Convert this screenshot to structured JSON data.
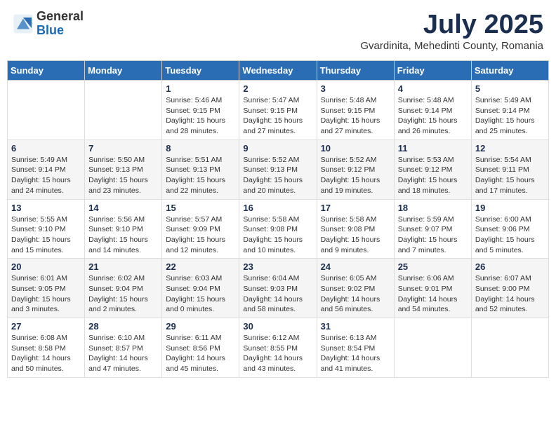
{
  "logo": {
    "general": "General",
    "blue": "Blue"
  },
  "title": "July 2025",
  "subtitle": "Gvardinita, Mehedinti County, Romania",
  "headers": [
    "Sunday",
    "Monday",
    "Tuesday",
    "Wednesday",
    "Thursday",
    "Friday",
    "Saturday"
  ],
  "weeks": [
    [
      {
        "day": "",
        "info": ""
      },
      {
        "day": "",
        "info": ""
      },
      {
        "day": "1",
        "info": "Sunrise: 5:46 AM\nSunset: 9:15 PM\nDaylight: 15 hours\nand 28 minutes."
      },
      {
        "day": "2",
        "info": "Sunrise: 5:47 AM\nSunset: 9:15 PM\nDaylight: 15 hours\nand 27 minutes."
      },
      {
        "day": "3",
        "info": "Sunrise: 5:48 AM\nSunset: 9:15 PM\nDaylight: 15 hours\nand 27 minutes."
      },
      {
        "day": "4",
        "info": "Sunrise: 5:48 AM\nSunset: 9:14 PM\nDaylight: 15 hours\nand 26 minutes."
      },
      {
        "day": "5",
        "info": "Sunrise: 5:49 AM\nSunset: 9:14 PM\nDaylight: 15 hours\nand 25 minutes."
      }
    ],
    [
      {
        "day": "6",
        "info": "Sunrise: 5:49 AM\nSunset: 9:14 PM\nDaylight: 15 hours\nand 24 minutes."
      },
      {
        "day": "7",
        "info": "Sunrise: 5:50 AM\nSunset: 9:13 PM\nDaylight: 15 hours\nand 23 minutes."
      },
      {
        "day": "8",
        "info": "Sunrise: 5:51 AM\nSunset: 9:13 PM\nDaylight: 15 hours\nand 22 minutes."
      },
      {
        "day": "9",
        "info": "Sunrise: 5:52 AM\nSunset: 9:13 PM\nDaylight: 15 hours\nand 20 minutes."
      },
      {
        "day": "10",
        "info": "Sunrise: 5:52 AM\nSunset: 9:12 PM\nDaylight: 15 hours\nand 19 minutes."
      },
      {
        "day": "11",
        "info": "Sunrise: 5:53 AM\nSunset: 9:12 PM\nDaylight: 15 hours\nand 18 minutes."
      },
      {
        "day": "12",
        "info": "Sunrise: 5:54 AM\nSunset: 9:11 PM\nDaylight: 15 hours\nand 17 minutes."
      }
    ],
    [
      {
        "day": "13",
        "info": "Sunrise: 5:55 AM\nSunset: 9:10 PM\nDaylight: 15 hours\nand 15 minutes."
      },
      {
        "day": "14",
        "info": "Sunrise: 5:56 AM\nSunset: 9:10 PM\nDaylight: 15 hours\nand 14 minutes."
      },
      {
        "day": "15",
        "info": "Sunrise: 5:57 AM\nSunset: 9:09 PM\nDaylight: 15 hours\nand 12 minutes."
      },
      {
        "day": "16",
        "info": "Sunrise: 5:58 AM\nSunset: 9:08 PM\nDaylight: 15 hours\nand 10 minutes."
      },
      {
        "day": "17",
        "info": "Sunrise: 5:58 AM\nSunset: 9:08 PM\nDaylight: 15 hours\nand 9 minutes."
      },
      {
        "day": "18",
        "info": "Sunrise: 5:59 AM\nSunset: 9:07 PM\nDaylight: 15 hours\nand 7 minutes."
      },
      {
        "day": "19",
        "info": "Sunrise: 6:00 AM\nSunset: 9:06 PM\nDaylight: 15 hours\nand 5 minutes."
      }
    ],
    [
      {
        "day": "20",
        "info": "Sunrise: 6:01 AM\nSunset: 9:05 PM\nDaylight: 15 hours\nand 3 minutes."
      },
      {
        "day": "21",
        "info": "Sunrise: 6:02 AM\nSunset: 9:04 PM\nDaylight: 15 hours\nand 2 minutes."
      },
      {
        "day": "22",
        "info": "Sunrise: 6:03 AM\nSunset: 9:04 PM\nDaylight: 15 hours\nand 0 minutes."
      },
      {
        "day": "23",
        "info": "Sunrise: 6:04 AM\nSunset: 9:03 PM\nDaylight: 14 hours\nand 58 minutes."
      },
      {
        "day": "24",
        "info": "Sunrise: 6:05 AM\nSunset: 9:02 PM\nDaylight: 14 hours\nand 56 minutes."
      },
      {
        "day": "25",
        "info": "Sunrise: 6:06 AM\nSunset: 9:01 PM\nDaylight: 14 hours\nand 54 minutes."
      },
      {
        "day": "26",
        "info": "Sunrise: 6:07 AM\nSunset: 9:00 PM\nDaylight: 14 hours\nand 52 minutes."
      }
    ],
    [
      {
        "day": "27",
        "info": "Sunrise: 6:08 AM\nSunset: 8:58 PM\nDaylight: 14 hours\nand 50 minutes."
      },
      {
        "day": "28",
        "info": "Sunrise: 6:10 AM\nSunset: 8:57 PM\nDaylight: 14 hours\nand 47 minutes."
      },
      {
        "day": "29",
        "info": "Sunrise: 6:11 AM\nSunset: 8:56 PM\nDaylight: 14 hours\nand 45 minutes."
      },
      {
        "day": "30",
        "info": "Sunrise: 6:12 AM\nSunset: 8:55 PM\nDaylight: 14 hours\nand 43 minutes."
      },
      {
        "day": "31",
        "info": "Sunrise: 6:13 AM\nSunset: 8:54 PM\nDaylight: 14 hours\nand 41 minutes."
      },
      {
        "day": "",
        "info": ""
      },
      {
        "day": "",
        "info": ""
      }
    ]
  ]
}
